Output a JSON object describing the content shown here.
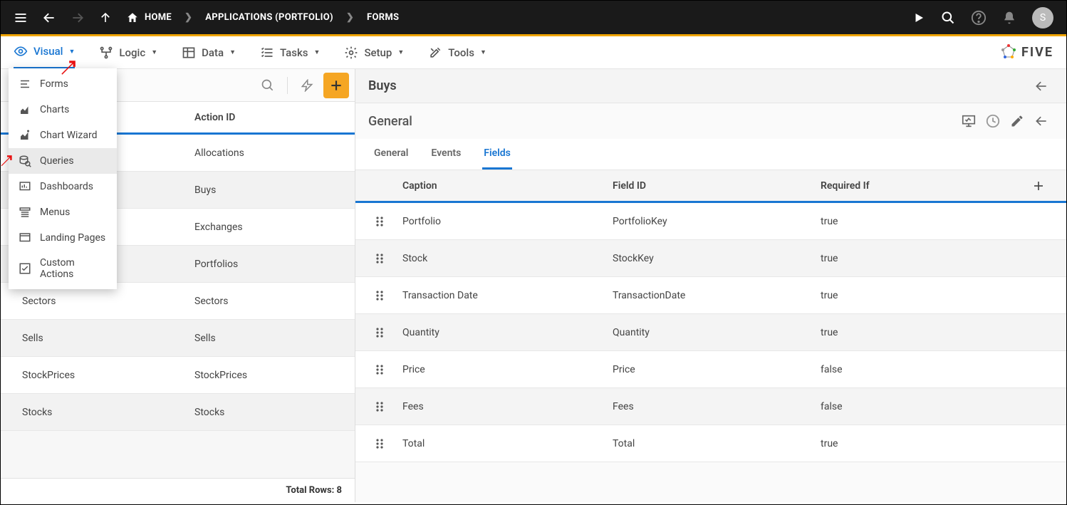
{
  "topbar": {
    "home": "HOME",
    "crumb1": "APPLICATIONS (PORTFOLIO)",
    "crumb2": "FORMS",
    "avatar": "S"
  },
  "menubar": {
    "visual": "Visual",
    "logic": "Logic",
    "data": "Data",
    "tasks": "Tasks",
    "setup": "Setup",
    "tools": "Tools",
    "brand": "FIVE"
  },
  "dropdown": {
    "forms": "Forms",
    "charts": "Charts",
    "chartwizard": "Chart Wizard",
    "queries": "Queries",
    "dashboards": "Dashboards",
    "menus": "Menus",
    "landing": "Landing Pages",
    "custom": "Custom Actions"
  },
  "leftpane": {
    "col_action_id": "Action ID",
    "rows": [
      {
        "title": "",
        "action": "Allocations"
      },
      {
        "title": "",
        "action": "Buys"
      },
      {
        "title": "",
        "action": "Exchanges"
      },
      {
        "title": "Portfolios",
        "action": "Portfolios"
      },
      {
        "title": "Sectors",
        "action": "Sectors"
      },
      {
        "title": "Sells",
        "action": "Sells"
      },
      {
        "title": "StockPrices",
        "action": "StockPrices"
      },
      {
        "title": "Stocks",
        "action": "Stocks"
      }
    ],
    "footer": "Total Rows: 8"
  },
  "rightpane": {
    "title": "Buys",
    "section": "General",
    "tabs": {
      "general": "General",
      "events": "Events",
      "fields": "Fields"
    },
    "cols": {
      "caption": "Caption",
      "fieldid": "Field ID",
      "required": "Required If"
    },
    "rows": [
      {
        "caption": "Portfolio",
        "fieldid": "PortfolioKey",
        "required": "true"
      },
      {
        "caption": "Stock",
        "fieldid": "StockKey",
        "required": "true"
      },
      {
        "caption": "Transaction Date",
        "fieldid": "TransactionDate",
        "required": "true"
      },
      {
        "caption": "Quantity",
        "fieldid": "Quantity",
        "required": "true"
      },
      {
        "caption": "Price",
        "fieldid": "Price",
        "required": "false"
      },
      {
        "caption": "Fees",
        "fieldid": "Fees",
        "required": "false"
      },
      {
        "caption": "Total",
        "fieldid": "Total",
        "required": "true"
      }
    ]
  }
}
